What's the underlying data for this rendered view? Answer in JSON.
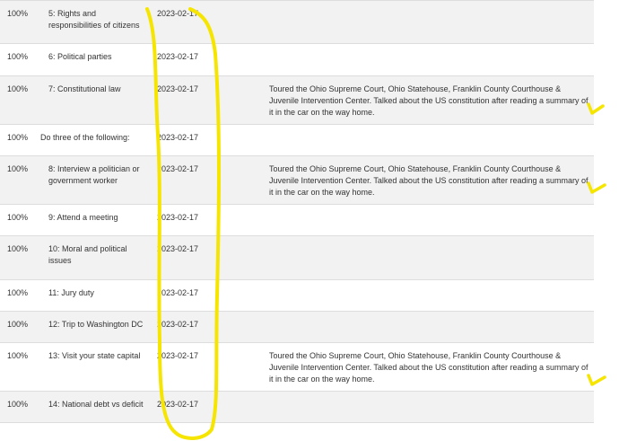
{
  "table": {
    "rows": [
      {
        "percent": "100%",
        "requirement": "5: Rights and responsibilities of citizens",
        "date": "2023-02-17",
        "notes": "",
        "group": false
      },
      {
        "percent": "100%",
        "requirement": "6: Political parties",
        "date": "2023-02-17",
        "notes": "",
        "group": false
      },
      {
        "percent": "100%",
        "requirement": "7: Constitutional law",
        "date": "2023-02-17",
        "notes": "Toured the Ohio Supreme Court, Ohio Statehouse, Franklin County Courthouse & Juvenile Intervention Center. Talked about the US constitution after reading a summary of it in the car on the way home.",
        "group": false
      },
      {
        "percent": "100%",
        "requirement": "Do three of the following:",
        "date": "2023-02-17",
        "notes": "",
        "group": true
      },
      {
        "percent": "100%",
        "requirement": "8: Interview a politician or government worker",
        "date": "2023-02-17",
        "notes": "Toured the Ohio Supreme Court, Ohio Statehouse, Franklin County Courthouse & Juvenile Intervention Center. Talked about the US constitution after reading a summary of it in the car on the way home.",
        "group": false
      },
      {
        "percent": "100%",
        "requirement": "9: Attend a meeting",
        "date": "2023-02-17",
        "notes": "",
        "group": false
      },
      {
        "percent": "100%",
        "requirement": "10: Moral and political issues",
        "date": "2023-02-17",
        "notes": "",
        "group": false
      },
      {
        "percent": "100%",
        "requirement": "11: Jury duty",
        "date": "2023-02-17",
        "notes": "",
        "group": false
      },
      {
        "percent": "100%",
        "requirement": "12: Trip to Washington DC",
        "date": "2023-02-17",
        "notes": "",
        "group": false
      },
      {
        "percent": "100%",
        "requirement": "13: Visit your state capital",
        "date": "2023-02-17",
        "notes": "Toured the Ohio Supreme Court, Ohio Statehouse, Franklin County Courthouse & Juvenile Intervention Center. Talked about the US constitution after reading a summary of it in the car on the way home.",
        "group": false
      },
      {
        "percent": "100%",
        "requirement": "14: National debt vs deficit",
        "date": "2023-02-17",
        "notes": "",
        "group": false
      }
    ]
  },
  "annotations": {
    "ink_color": "#f5e500",
    "marks": [
      "date-column-circle",
      "checkmark",
      "checkmark",
      "checkmark"
    ]
  }
}
